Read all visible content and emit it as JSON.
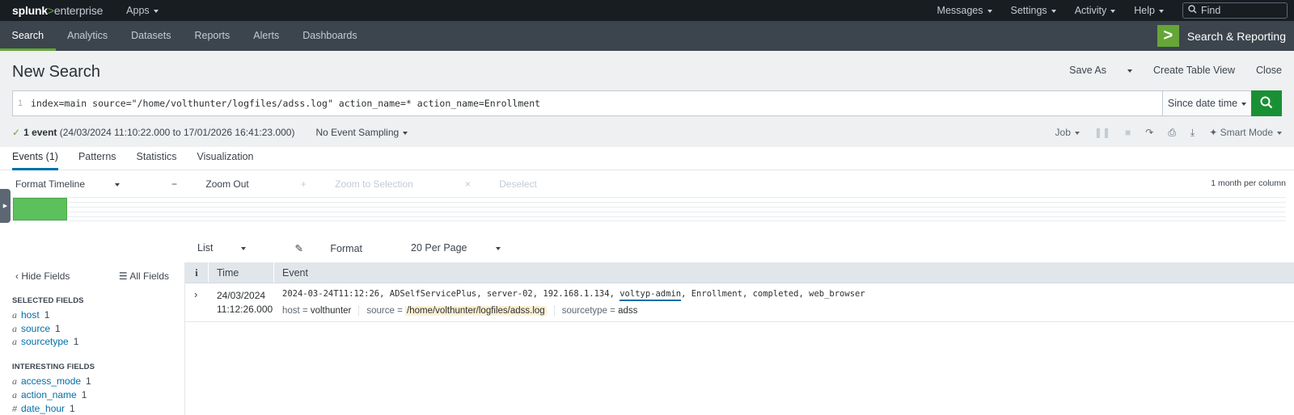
{
  "topbar": {
    "logo_splunk": "splunk",
    "logo_gt": ">",
    "logo_enterprise": "enterprise",
    "apps": "Apps",
    "menus": [
      "Messages",
      "Settings",
      "Activity",
      "Help"
    ],
    "find_placeholder": "Find"
  },
  "appnav": {
    "items": [
      "Search",
      "Analytics",
      "Datasets",
      "Reports",
      "Alerts",
      "Dashboards"
    ],
    "active": "Search",
    "app_name": "Search & Reporting",
    "accent": "#65a637"
  },
  "search": {
    "title": "New Search",
    "actions": [
      "Save As",
      "Create Table View",
      "Close"
    ],
    "line_number": "1",
    "query": "index=main source=\"/home/volthunter/logfiles/adss.log\" action_name=* action_name=Enrollment",
    "time_range": "Since date time",
    "status_count": "1 event",
    "status_range": "(24/03/2024 11:10:22.000 to 17/01/2026 16:41:23.000)",
    "sampling": "No Event Sampling",
    "job": "Job",
    "mode": "Smart Mode"
  },
  "tabs": [
    "Events (1)",
    "Patterns",
    "Statistics",
    "Visualization"
  ],
  "timeline": {
    "format": "Format Timeline",
    "zoom_out": "Zoom Out",
    "zoom_selection": "Zoom to Selection",
    "deselect": "Deselect",
    "scale": "1 month per column",
    "bar_color": "#5cc05c"
  },
  "results_controls": {
    "list": "List",
    "format": "Format",
    "per_page": "20 Per Page"
  },
  "fields": {
    "hide": "Hide Fields",
    "all": "All Fields",
    "selected_title": "SELECTED FIELDS",
    "selected": [
      {
        "type": "a",
        "name": "host",
        "count": "1"
      },
      {
        "type": "a",
        "name": "source",
        "count": "1"
      },
      {
        "type": "a",
        "name": "sourcetype",
        "count": "1"
      }
    ],
    "interesting_title": "INTERESTING FIELDS",
    "interesting": [
      {
        "type": "a",
        "name": "access_mode",
        "count": "1"
      },
      {
        "type": "a",
        "name": "action_name",
        "count": "1"
      },
      {
        "type": "#",
        "name": "date_hour",
        "count": "1"
      }
    ]
  },
  "table": {
    "col_info": "i",
    "col_time": "Time",
    "col_event": "Event",
    "rows": [
      {
        "date": "24/03/2024",
        "time": "11:12:26.000",
        "event_pre": "2024-03-24T11:12:26, ADSelfServicePlus, server-02, 192.168.1.134, ",
        "event_hl": "voltyp-admin",
        "event_post": ", Enrollment, completed, web_browser",
        "host_key": "host =",
        "host": "volthunter",
        "source_key": "source =",
        "source": "/home/volthunter/logfiles/adss.log",
        "sourcetype_key": "sourcetype =",
        "sourcetype": "adss"
      }
    ]
  }
}
